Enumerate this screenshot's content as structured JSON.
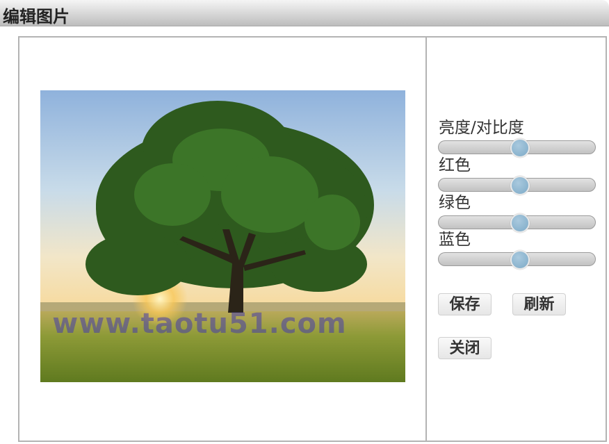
{
  "window": {
    "title": "编辑图片"
  },
  "image": {
    "alt": "tree",
    "watermark": "www.taotu51.com"
  },
  "controls": [
    {
      "label": "亮度/对比度",
      "value": 0.52
    },
    {
      "label": "红色",
      "value": 0.52
    },
    {
      "label": "绿色",
      "value": 0.52
    },
    {
      "label": "蓝色",
      "value": 0.52
    }
  ],
  "buttons": {
    "save": "保存",
    "refresh": "刷新",
    "close": "关闭"
  }
}
